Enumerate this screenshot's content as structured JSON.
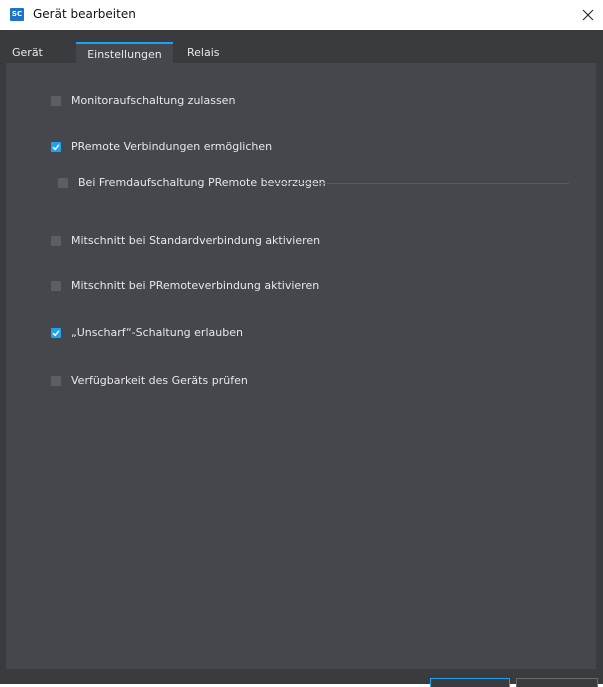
{
  "window": {
    "title": "Gerät bearbeiten",
    "app_icon_text": "SC"
  },
  "tabs": [
    {
      "label": "Gerät",
      "active": false
    },
    {
      "label": "Einstellungen",
      "active": true
    },
    {
      "label": "Relais",
      "active": false
    }
  ],
  "options": [
    {
      "label": "Monitoraufschaltung zulassen",
      "checked": false
    },
    {
      "label": "PRemote Verbindungen ermöglichen",
      "checked": true
    },
    {
      "label": "Bei Fremdaufschaltung PRemote bevorzugen",
      "checked": false
    },
    {
      "label": "Mitschnitt bei Standardverbindung aktivieren",
      "checked": false
    },
    {
      "label": "Mitschnitt bei PRemoteverbindung aktivieren",
      "checked": false
    },
    {
      "label": "„Unscharf“-Schaltung erlauben",
      "checked": true
    },
    {
      "label": "Verfügbarkeit des Geräts prüfen",
      "checked": false
    }
  ],
  "colors": {
    "accent": "#1ea3f0",
    "panel": "#46474c",
    "background": "#3a3b3f"
  }
}
